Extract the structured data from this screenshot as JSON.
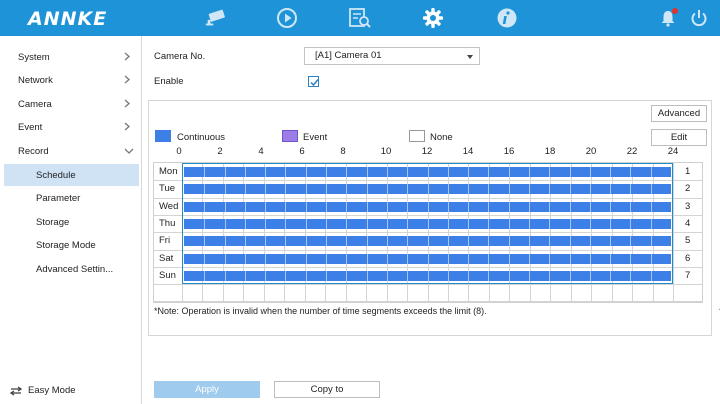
{
  "brand": "ANNKE",
  "topbar": {
    "icons": [
      "live-view-camera-icon",
      "playback-icon",
      "search-file-icon",
      "settings-gear-icon",
      "info-icon"
    ],
    "active": "settings-gear-icon",
    "right_icons": [
      "notification-bell-icon",
      "power-icon"
    ],
    "colors": {
      "bar": "#1f93d7",
      "alert_dot": "#e0322b"
    }
  },
  "sidebar": {
    "items": [
      {
        "label": "System",
        "arrow": "chevron-right-icon"
      },
      {
        "label": "Network",
        "arrow": "chevron-right-icon"
      },
      {
        "label": "Camera",
        "arrow": "chevron-right-icon"
      },
      {
        "label": "Event",
        "arrow": "chevron-right-icon"
      },
      {
        "label": "Record",
        "arrow": "chevron-down-icon"
      }
    ],
    "subitems": [
      {
        "label": "Schedule",
        "active": true
      },
      {
        "label": "Parameter"
      },
      {
        "label": "Storage"
      },
      {
        "label": "Storage Mode"
      },
      {
        "label": "Advanced Settin..."
      }
    ],
    "easy_mode": "Easy Mode"
  },
  "form": {
    "camera_label": "Camera No.",
    "camera_value": "[A1] Camera 01",
    "enable_label": "Enable",
    "enable_checked": true
  },
  "buttons": {
    "advanced": "Advanced",
    "edit": "Edit",
    "apply": "Apply",
    "copy_to": "Copy to"
  },
  "legend": [
    {
      "label": "Continuous",
      "color": "#3c7fe6"
    },
    {
      "label": "Event",
      "color": "#9b7de8"
    },
    {
      "label": "None",
      "color": "#ffffff"
    }
  ],
  "hours": [
    "0",
    "2",
    "4",
    "6",
    "8",
    "10",
    "12",
    "14",
    "16",
    "18",
    "20",
    "22",
    "24"
  ],
  "days": [
    {
      "name": "Mon",
      "num": "1"
    },
    {
      "name": "Tue",
      "num": "2"
    },
    {
      "name": "Wed",
      "num": "3"
    },
    {
      "name": "Thu",
      "num": "4"
    },
    {
      "name": "Fri",
      "num": "5"
    },
    {
      "name": "Sat",
      "num": "6"
    },
    {
      "name": "Sun",
      "num": "7"
    }
  ],
  "schedule_mode": "Continuous",
  "note": "*Note: Operation is invalid when the number of time segments exceeds the limit (8)."
}
